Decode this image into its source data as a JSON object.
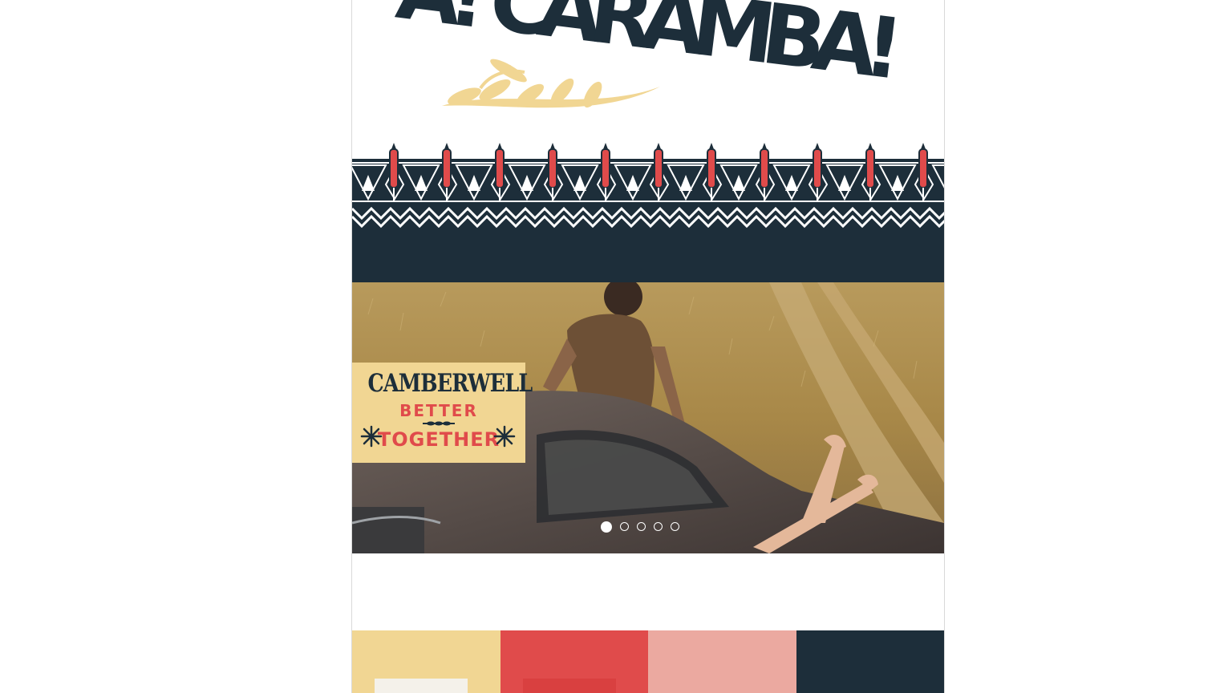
{
  "brand": {
    "title": "A! CARAMBA!"
  },
  "badge": {
    "line1": "CAMBERWELL",
    "line2": "BETTER",
    "line3": "TOGETHER"
  },
  "carousel": {
    "slide_count": 5,
    "active_index": 0
  },
  "palette": {
    "colors": [
      "#f1d693",
      "#e04b4b",
      "#eba9a0",
      "#1d2e3a"
    ]
  },
  "colors": {
    "navy": "#1d2e3a",
    "cream": "#f1d693",
    "red": "#e04b4b",
    "pink": "#eba9a0"
  }
}
